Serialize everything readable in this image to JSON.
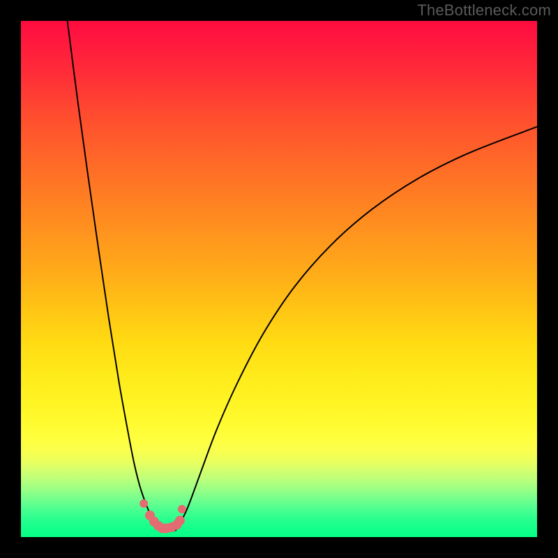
{
  "watermark": "TheBottleneck.com",
  "chart_data": {
    "type": "line",
    "title": "",
    "xlabel": "",
    "ylabel": "",
    "xlim": [
      0,
      100
    ],
    "ylim": [
      0,
      100
    ],
    "grid": false,
    "legend": false,
    "minimum_x": 27,
    "minimum_width": 6,
    "left_branch": {
      "x": [
        9.0,
        11.0,
        13.0,
        15.0,
        17.0,
        19.0,
        21.0,
        22.0,
        23.0,
        24.0,
        25.0,
        25.5,
        26.0,
        26.5,
        27.0
      ],
      "y": [
        100.0,
        84.5,
        70.0,
        56.0,
        42.5,
        30.0,
        19.0,
        14.0,
        10.0,
        7.0,
        4.5,
        3.5,
        2.8,
        2.0,
        1.5
      ]
    },
    "right_branch": {
      "x": [
        30.0,
        30.5,
        31.0,
        32.0,
        33.0,
        35.0,
        38.0,
        42.0,
        47.0,
        53.0,
        60.0,
        68.0,
        77.0,
        87.0,
        100.0
      ],
      "y": [
        1.5,
        2.0,
        3.0,
        5.0,
        7.5,
        13.0,
        21.0,
        30.0,
        39.5,
        48.5,
        56.5,
        63.5,
        69.5,
        74.5,
        79.5
      ]
    },
    "floor_segment": {
      "x": [
        27.0,
        30.0
      ],
      "y": [
        1.3,
        1.3
      ]
    },
    "scatter_pink": {
      "x": [
        23.8,
        25.0,
        25.8,
        26.6,
        27.4,
        28.2,
        29.2,
        30.2,
        30.8,
        31.2
      ],
      "y": [
        6.5,
        4.2,
        3.0,
        2.2,
        1.7,
        1.7,
        1.9,
        2.4,
        3.2,
        5.4
      ]
    },
    "colors": {
      "curve": "#000000",
      "scatter": "#e46b71",
      "gradient_top": "#ff0b3e",
      "gradient_bottom": "#06ff85",
      "background": "#000000"
    }
  }
}
